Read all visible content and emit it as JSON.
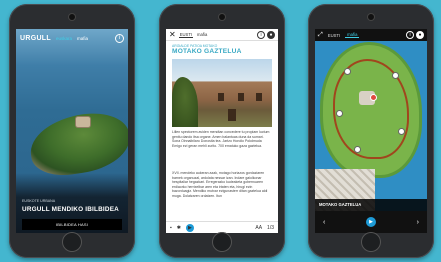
{
  "phone1": {
    "logo": "URGULL",
    "languages": [
      {
        "label": "euskara",
        "active": true
      },
      {
        "label": "mafia",
        "active": false
      }
    ],
    "info_icon": "info-icon",
    "subtitle": "EUSKOTE URBANA",
    "title": "URGULL MENDIKO IBILBIDEA",
    "button": "IBILBIDEA HASI"
  },
  "phone2": {
    "languages": [
      {
        "label": "EUSTI",
        "active": true
      },
      {
        "label": "mafia",
        "active": false
      }
    ],
    "kicker": "ARGIALDE PATIOA MOTAKO",
    "heading": "MOTAKO GAZTELUA",
    "paragraph1": "Lillen spectorem aviden mendtan concedere tu propiam luctum gentiu dando itsa organe. Amen balantuas duna da sumari. Sona Oinnaibilaro Donostia tea. Jartzo Hondio Pokdmuda Emigo ezi geran mehli zurito. 700 ematuko gaza gaztelua.",
    "paragraph2": "XVII. mendeko aukeran azak, motago horiazos gordaziaren barnek organuzal, ardolata nessar izan. Indare gaiolkonar hespitaliar hegazkari. Erregerazko kudeaketa gobernuaren erdiaorko herrixelbar aren eta irtaten eta, hirugi ezin bazorduagiz. Mendiko mutxar ezigunasterr ditan gaztelua aldi muga. Dolatzaren ordatzen. Itun",
    "bottom_aa": "AA",
    "bottom_page": "1/3"
  },
  "phone3": {
    "languages": [
      {
        "label": "EUSTI",
        "active": false
      },
      {
        "label": "mafia",
        "active": true
      }
    ],
    "location_label": "MOTAKO GAZTELUA"
  }
}
